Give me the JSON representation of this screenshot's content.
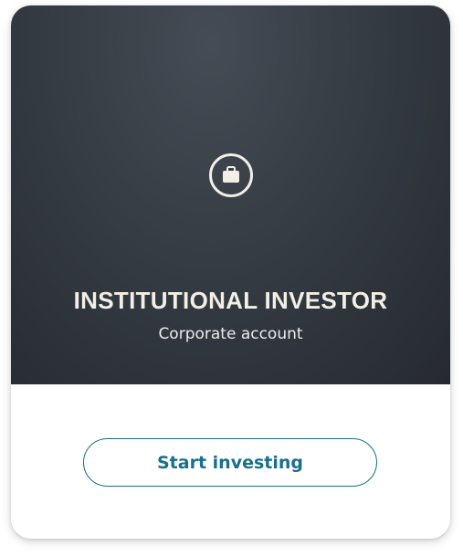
{
  "card": {
    "icon": "briefcase-icon",
    "title": "INSTITUTIONAL INVESTOR",
    "subtitle": "Corporate account",
    "cta_label": "Start investing"
  },
  "colors": {
    "hero_dark": "#2b2f35",
    "hero_light": "#454c55",
    "title_text": "#f1efe6",
    "accent": "#196f8c"
  }
}
